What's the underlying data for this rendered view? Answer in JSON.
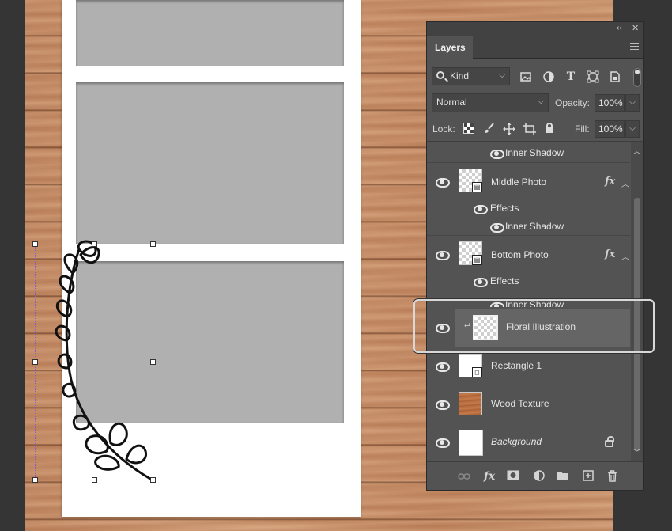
{
  "panel": {
    "collapse_glyph": "‹‹",
    "close_glyph": "✕",
    "tab_label": "Layers",
    "filter": {
      "kind_label": "Kind",
      "filter_icons": [
        "image-filter-icon",
        "adjustment-filter-icon",
        "type-filter-icon",
        "shape-filter-icon",
        "smart-object-filter-icon"
      ],
      "type_glyph": "T"
    },
    "blend": {
      "mode": "Normal",
      "opacity_label": "Opacity:",
      "opacity_value": "100%"
    },
    "lock": {
      "label": "Lock:",
      "fill_label": "Fill:",
      "fill_value": "100%"
    },
    "layers": [
      {
        "type": "effect-sub",
        "label": "Inner Shadow"
      },
      {
        "type": "layer",
        "name": "Middle Photo",
        "fx": "fx",
        "visible": true
      },
      {
        "type": "effect-header",
        "label": "Effects"
      },
      {
        "type": "effect-sub",
        "label": "Inner Shadow"
      },
      {
        "type": "layer",
        "name": "Bottom Photo",
        "fx": "fx",
        "visible": true
      },
      {
        "type": "effect-header",
        "label": "Effects"
      },
      {
        "type": "effect-sub-clipped",
        "label": "Inner Shadow"
      },
      {
        "type": "layer",
        "name": "Floral Illustration",
        "selected": true,
        "clipped": true,
        "visible": true
      },
      {
        "type": "layer",
        "name": "Rectangle 1",
        "visible": true
      },
      {
        "type": "layer",
        "name": "Wood Texture",
        "visible": true
      },
      {
        "type": "layer",
        "name": "Background",
        "locked": true,
        "visible": true
      }
    ],
    "bottom_icons": [
      "link-layers-icon",
      "add-style-icon",
      "add-mask-icon",
      "adjustment-layer-icon",
      "new-group-icon",
      "new-layer-icon",
      "delete-layer-icon"
    ],
    "bottom_fx_glyph": "fx"
  },
  "colors": {
    "panel_bg": "#535353",
    "selected_row": "#656565",
    "photo_placeholder": "#b0b0b0",
    "wood": "#c38a64"
  }
}
